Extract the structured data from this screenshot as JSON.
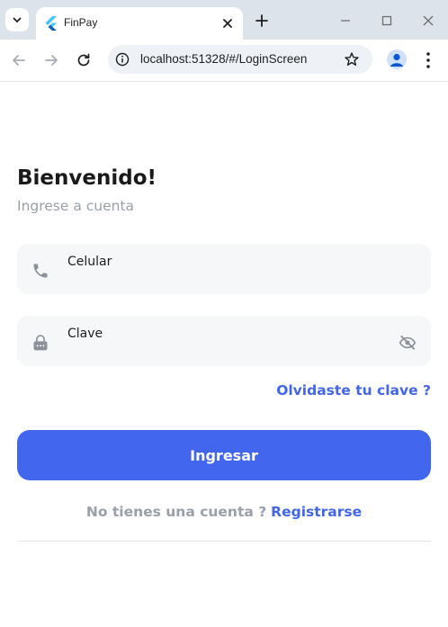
{
  "browser": {
    "tab_title": "FinPay",
    "url": "localhost:51328/#/LoginScreen"
  },
  "login": {
    "heading": "Bienvenido!",
    "subtitle": "Ingrese a cuenta",
    "phone_label": "Celular",
    "password_label": "Clave",
    "forgot_link": "Olvidaste tu clave ?",
    "submit_label": "Ingresar",
    "no_account_text": "No tienes una cuenta ?",
    "register_link": "Registrarse"
  },
  "colors": {
    "accent": "#4366ef",
    "link": "#4366e8",
    "muted_text": "#9aa0aa",
    "field_bg": "#f6f7f8"
  },
  "icons": {
    "phone": "phone-icon",
    "lock": "lock-icon",
    "visibility": "eye-off-icon",
    "favicon": "flutter-logo-icon"
  }
}
